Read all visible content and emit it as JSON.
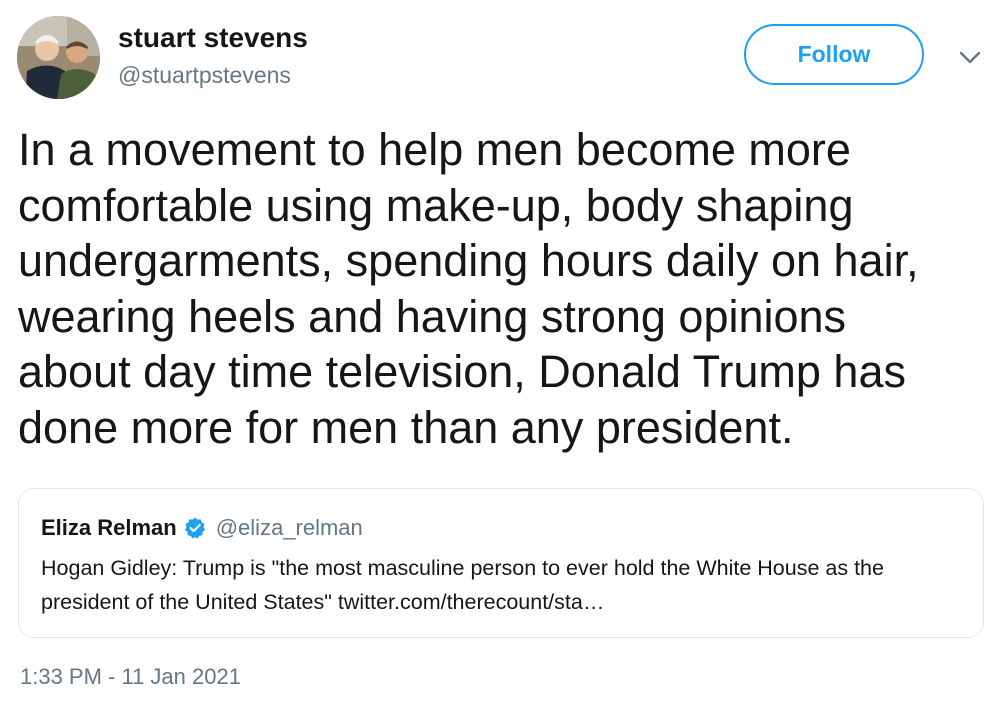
{
  "author": {
    "display_name": "stuart stevens",
    "handle": "@stuartpstevens",
    "avatar_icon": "profile-photo"
  },
  "follow_button": {
    "label": "Follow",
    "color": "#1da1f2"
  },
  "more_menu": {
    "icon": "chevron-down-icon"
  },
  "tweet": {
    "text": "In a movement to help men become more\ncomfortable using make-up, body shaping\nundergarments, spending hours daily on hair,\nwearing heels and having strong opinions\nabout day time television, Donald Trump has\ndone more for men than any president."
  },
  "quoted_tweet": {
    "display_name": "Eliza Relman",
    "verified_icon": "verified-badge-icon",
    "handle": "@eliza_relman",
    "text": "Hogan Gidley: Trump is \"the most masculine person to ever hold the White House as the president of the United States\" twitter.com/therecount/sta…"
  },
  "timestamp": "1:33 PM - 11 Jan 2021",
  "colors": {
    "text": "#14171a",
    "secondary_text": "#657786",
    "accent": "#1da1f2",
    "card_border": "#e1e8ed"
  }
}
